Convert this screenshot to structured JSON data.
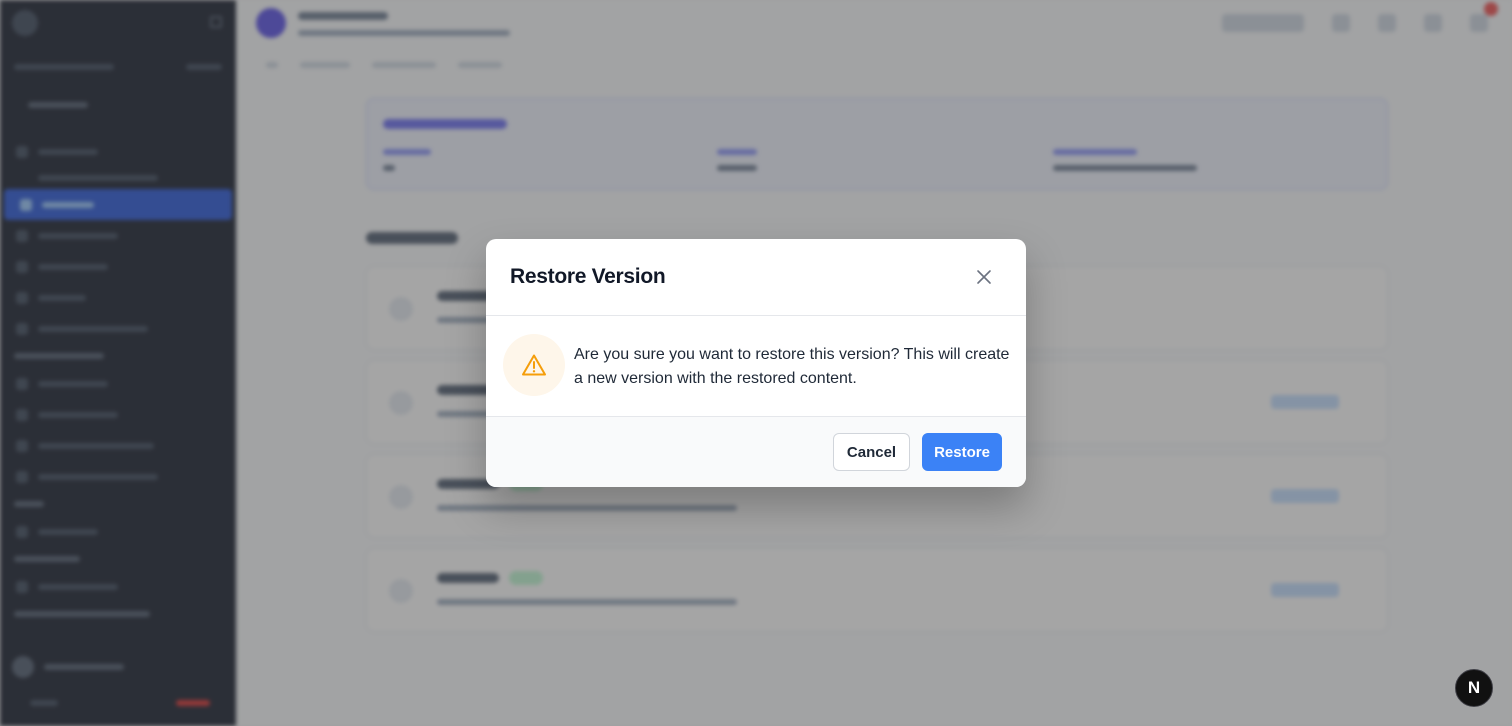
{
  "dialog": {
    "title": "Restore Version",
    "message": "Are you sure you want to restore this version? This will create a new version with the restored content.",
    "cancel_label": "Cancel",
    "confirm_label": "Restore",
    "close_icon": "close-icon",
    "warning_icon": "warning-triangle-icon"
  },
  "dev_badge": {
    "label": "N"
  },
  "colors": {
    "primary": "#3b82f6",
    "warning": "#f59e0b",
    "warning_bg": "#fef6ea",
    "sidebar_bg": "#0b1222",
    "overlay": "rgba(75,75,75,0.5)"
  }
}
